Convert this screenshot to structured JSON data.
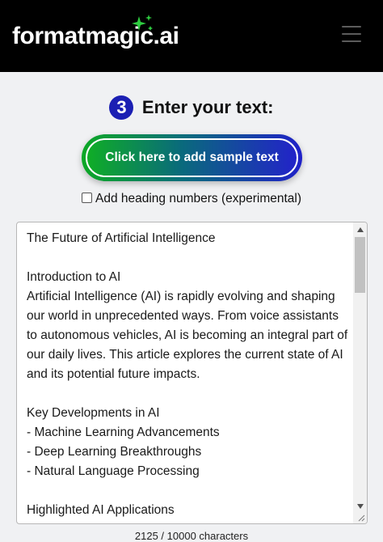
{
  "header": {
    "logo_text": "formatmagic.ai",
    "sparkle_icon": "sparkle-icon",
    "menu_icon": "hamburger-menu-icon",
    "accent_color": "#2ecc40"
  },
  "step": {
    "number": "3",
    "title": "Enter your text:",
    "badge_color": "#1b1fb3"
  },
  "sample_button": {
    "label": "Click here to add sample text"
  },
  "options": {
    "heading_numbers_label": "Add heading numbers (experimental)",
    "heading_numbers_checked": false
  },
  "editor": {
    "content": "The Future of Artificial Intelligence\n\nIntroduction to AI\nArtificial Intelligence (AI) is rapidly evolving and shaping our world in unprecedented ways. From voice assistants to autonomous vehicles, AI is becoming an integral part of our daily lives. This article explores the current state of AI and its potential future impacts.\n\nKey Developments in AI\n- Machine Learning Advancements\n- Deep Learning Breakthroughs\n- Natural Language Processing\n\nHighlighted AI Applications"
  },
  "counter": {
    "text": "2125 / 10000 characters"
  }
}
